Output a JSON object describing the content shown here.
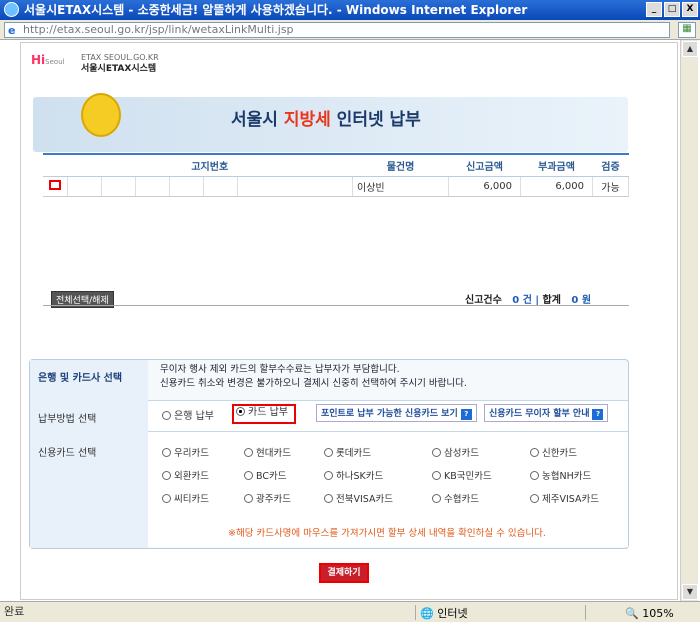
{
  "window": {
    "title": "서울시ETAX시스템 - 소중한세금! 알뜰하게 사용하겠습니다. - Windows Internet Explorer",
    "address": "http://etax.seoul.go.kr/jsp/link/wetaxLinkMulti.jsp",
    "min": "_",
    "max": "□",
    "close": "X"
  },
  "logo": {
    "mark": "Hi",
    "sub": "Seoul",
    "line1": "ETAX SEOUL.GO.KR",
    "line2": "서울시ETAX시스템"
  },
  "hero": {
    "title_pre": "서울시 ",
    "title_hl": "지방세",
    "title_post": " 인터넷 납부"
  },
  "grid": {
    "headers": [
      "고지번호",
      "물건명",
      "신고금액",
      "부과금액",
      "검증"
    ],
    "row": {
      "name": "이상빈",
      "declared": "6,000",
      "assessed": "6,000",
      "status": "가능"
    }
  },
  "select_all": "전체선택/해제",
  "summary": {
    "count_label": "신고건수",
    "count": "0 건",
    "sep": "|",
    "total_label": "합계",
    "total": "0 원"
  },
  "payment": {
    "header": "은행 및 카드사 선택",
    "note1": "무이자 행사 제외 카드의 할부수수료는 납부자가 부담합니다.",
    "note2": "신용카드 취소와 변경은 불가하오니 결제시 신중히 선택하여 주시기 바랍니다.",
    "method_label": "납부방법 선택",
    "bank": "은행 납부",
    "card": "카드 납부",
    "link1": "포인트로 납부 가능한 신용카드 보기",
    "link2": "신용카드 무이자 할부 안내",
    "q": "?",
    "card_label": "신용카드 선택",
    "cards": [
      "우리카드",
      "현대카드",
      "롯데카드",
      "삼성카드",
      "신한카드",
      "외환카드",
      "BC카드",
      "하나SK카드",
      "KB국민카드",
      "농협NH카드",
      "씨티카드",
      "광주카드",
      "전북VISA카드",
      "수협카드",
      "제주VISA카드"
    ],
    "warn": "※해당 카드사명에 마우스를 가져가시면 할부 상세 내역을 확인하실 수 있습니다."
  },
  "pay_button": "결제하기",
  "status": {
    "done": "완료",
    "zone": "인터넷",
    "zoom": "105%"
  }
}
